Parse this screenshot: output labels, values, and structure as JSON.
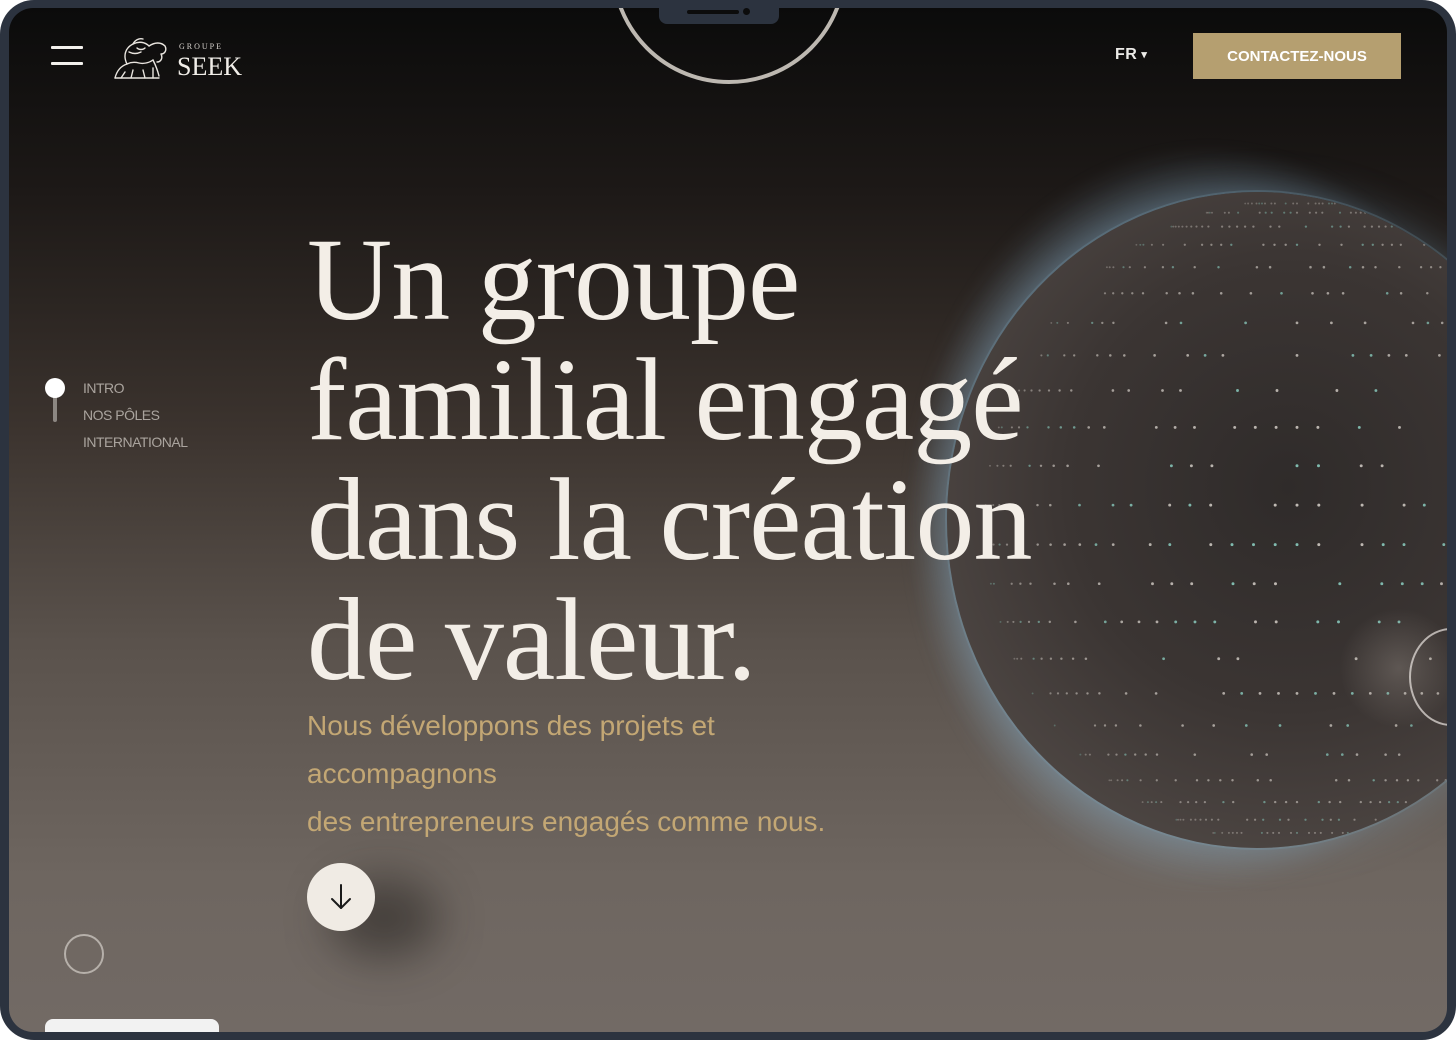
{
  "header": {
    "menu_icon": "hamburger-icon",
    "logo": {
      "small": "GROUPE",
      "big": "SEEK"
    },
    "lang": {
      "label": "FR",
      "caret": "▾"
    },
    "contact_label": "CONTACTEZ-NOUS"
  },
  "side_nav": {
    "items": [
      "INTRO",
      "NOS PÔLES",
      "INTERNATIONAL"
    ],
    "active_index": 0
  },
  "hero": {
    "headline_lines": [
      "Un groupe",
      "familial engagé",
      "dans la création",
      "de valeur."
    ],
    "sub_lines": [
      "Nous développons des projets et",
      "accompagnons",
      "des entrepreneurs engagés comme nous."
    ],
    "scroll_icon": "arrow-down-icon"
  },
  "colors": {
    "accent": "#b59f70",
    "subtitle": "#c3a774",
    "headline": "#f3eee7",
    "frame": "#2c333f"
  }
}
